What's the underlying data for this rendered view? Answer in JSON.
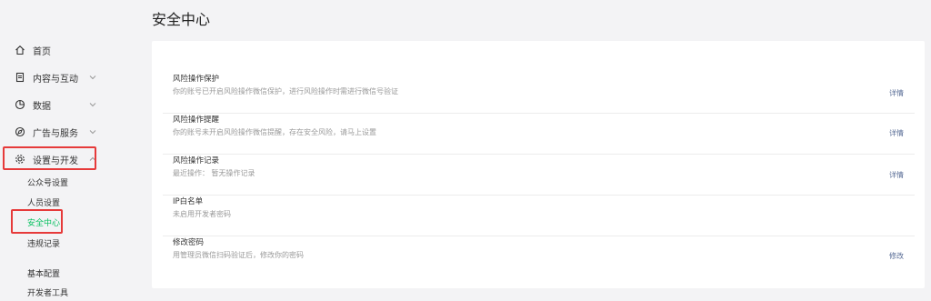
{
  "page": {
    "title": "安全中心"
  },
  "sidebar": {
    "items": [
      {
        "label": "首页",
        "icon": "home-icon"
      },
      {
        "label": "内容与互动",
        "icon": "document-icon"
      },
      {
        "label": "数据",
        "icon": "pie-chart-icon"
      },
      {
        "label": "广告与服务",
        "icon": "compass-icon"
      },
      {
        "label": "设置与开发",
        "icon": "gear-icon"
      }
    ],
    "sub_items": [
      {
        "label": "公众号设置"
      },
      {
        "label": "人员设置"
      },
      {
        "label": "安全中心",
        "active": true
      },
      {
        "label": "违规记录"
      },
      {
        "label": "基本配置"
      },
      {
        "label": "开发者工具"
      }
    ]
  },
  "security": {
    "rows": [
      {
        "title": "风险操作保护",
        "desc": "你的账号已开启风险操作微信保护，进行风险操作时需进行微信号验证",
        "action": "详情"
      },
      {
        "title": "风险操作提醒",
        "desc": "你的账号未开启风险操作微信提醒，存在安全风险，请马上设置",
        "action": "详情"
      },
      {
        "title": "风险操作记录",
        "desc": "最近操作：  暂无操作记录",
        "action": "详情"
      },
      {
        "title": "IP白名单",
        "desc": "未启用开发者密码",
        "action": ""
      },
      {
        "title": "修改密码",
        "desc": "用管理员微信扫码验证后，修改你的密码",
        "action": "修改"
      }
    ]
  },
  "colors": {
    "accent": "#07c160",
    "link": "#576b95",
    "highlight": "#e63a3a"
  }
}
